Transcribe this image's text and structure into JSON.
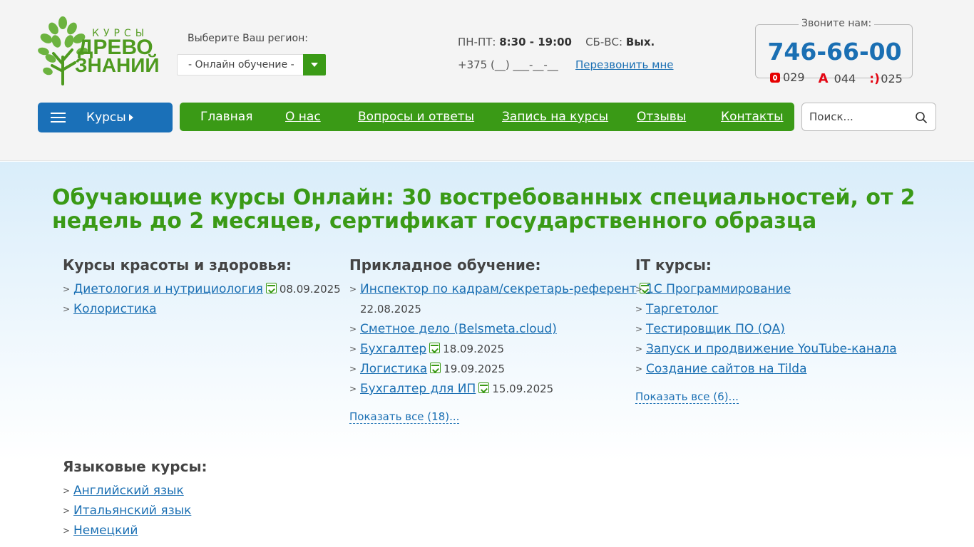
{
  "logo": {
    "small_text": "КУРСЫ",
    "line1": "ДРЕВО",
    "line2": "ЗНАНИЙ"
  },
  "region": {
    "label": "Выберите Ваш регион:",
    "selected": "- Онлайн обучение -"
  },
  "hours": {
    "weekdays_label": "ПН-ПТ:",
    "weekdays_value": "8:30 - 19:00",
    "weekend_label": "СБ-ВС:",
    "weekend_value": "Вых."
  },
  "phone_input": {
    "mask": "+375 (__) ___-__-__"
  },
  "callback_link": "Перезвонить мне",
  "call_box": {
    "label": "Звоните нам:",
    "number": "746-66-00",
    "operators": [
      "029",
      "044",
      "025"
    ]
  },
  "menu_button": {
    "label": "Курсы"
  },
  "nav": {
    "items": [
      "Главная",
      "О нас",
      "Вопросы и ответы",
      "Запись на курсы",
      "Отзывы",
      "Контакты"
    ]
  },
  "search": {
    "placeholder": "Поиск..."
  },
  "headline": {
    "bold": "Обучающие курсы Онлайн:",
    "rest": "30 востребованных специальностей, от 2 недель до 2 месяцев, сертификат государственного образца"
  },
  "columns": [
    {
      "title": "Курсы красоты и здоровья:",
      "items": [
        {
          "name": "Диетология и нутрициология",
          "date": "08.09.2025"
        },
        {
          "name": "Колористика",
          "date": ""
        }
      ],
      "show_all": ""
    },
    {
      "title": "Прикладное обучение:",
      "items": [
        {
          "name": "Инспектор по кадрам/секретарь-референт",
          "date": "22.08.2025"
        },
        {
          "name": "Сметное дело (Belsmeta.cloud)",
          "date": ""
        },
        {
          "name": "Бухгалтер",
          "date": "18.09.2025"
        },
        {
          "name": "Логистика",
          "date": "19.09.2025"
        },
        {
          "name": "Бухгалтер для ИП",
          "date": "15.09.2025"
        }
      ],
      "show_all": "Показать все (18)..."
    },
    {
      "title": "IT курсы:",
      "items": [
        {
          "name": "1С Программирование",
          "date": ""
        },
        {
          "name": "Таргетолог",
          "date": ""
        },
        {
          "name": "Тестировщик ПО (QA)",
          "date": ""
        },
        {
          "name": "Запуск и продвижение YouTube-канала",
          "date": ""
        },
        {
          "name": "Создание сайтов на Tilda",
          "date": ""
        }
      ],
      "show_all": "Показать все (6)..."
    },
    {
      "title": "Языковые курсы:",
      "items": [
        {
          "name": "Английский язык",
          "date": ""
        },
        {
          "name": "Итальянский язык",
          "date": ""
        },
        {
          "name": "Немецкий",
          "date": ""
        }
      ],
      "show_all": ""
    }
  ],
  "colors": {
    "green": "#3a9a16",
    "blue": "#1a70b8",
    "link": "#1a6fb3"
  }
}
